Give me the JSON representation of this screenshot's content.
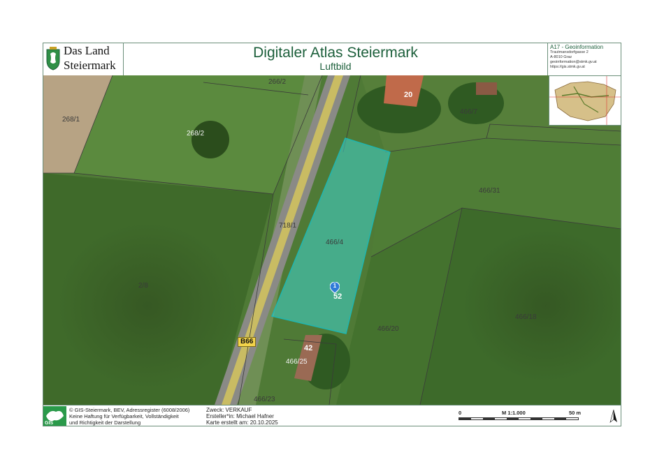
{
  "header": {
    "logo_line1": "Das Land",
    "logo_line2": "Steiermark",
    "title": "Digitaler Atlas Steiermark",
    "subtitle": "Luftbild",
    "agency_name": "A17 - Geoinformation",
    "agency_street": "Trautmansdorfgasse 2",
    "agency_city": "A-8010 Graz",
    "agency_email": "geoinformation@stmk.gv.at",
    "agency_url": "https://gis.stmk.gv.at"
  },
  "map": {
    "parcel_labels": [
      "266/2",
      "268/1",
      "268/2",
      "466/7",
      "466/31",
      "718/1",
      "466/4",
      "2/8",
      "466/20",
      "466/18",
      "466/25",
      "466/23"
    ],
    "house_numbers": [
      "20",
      "52",
      "42"
    ],
    "road_label": "B66",
    "pin_label": "1",
    "highlight_color": "#3fd6d0"
  },
  "footer": {
    "copyright": "© GIS-Steiermark, BEV, Adressregister (6008/2006)",
    "disclaimer1": "Keine Haftung für Verfügbarkeit, Vollständigkeit",
    "disclaimer2": "und Richtigkeit der Darstellung",
    "purpose": "Zweck: VERKAUF",
    "author": "Ersteller*in: Michael Hafner",
    "created": "Karte erstellt am: 20.10.2025",
    "scale_start": "0",
    "scale_ratio": "M 1:1.000",
    "scale_end": "50 m"
  }
}
